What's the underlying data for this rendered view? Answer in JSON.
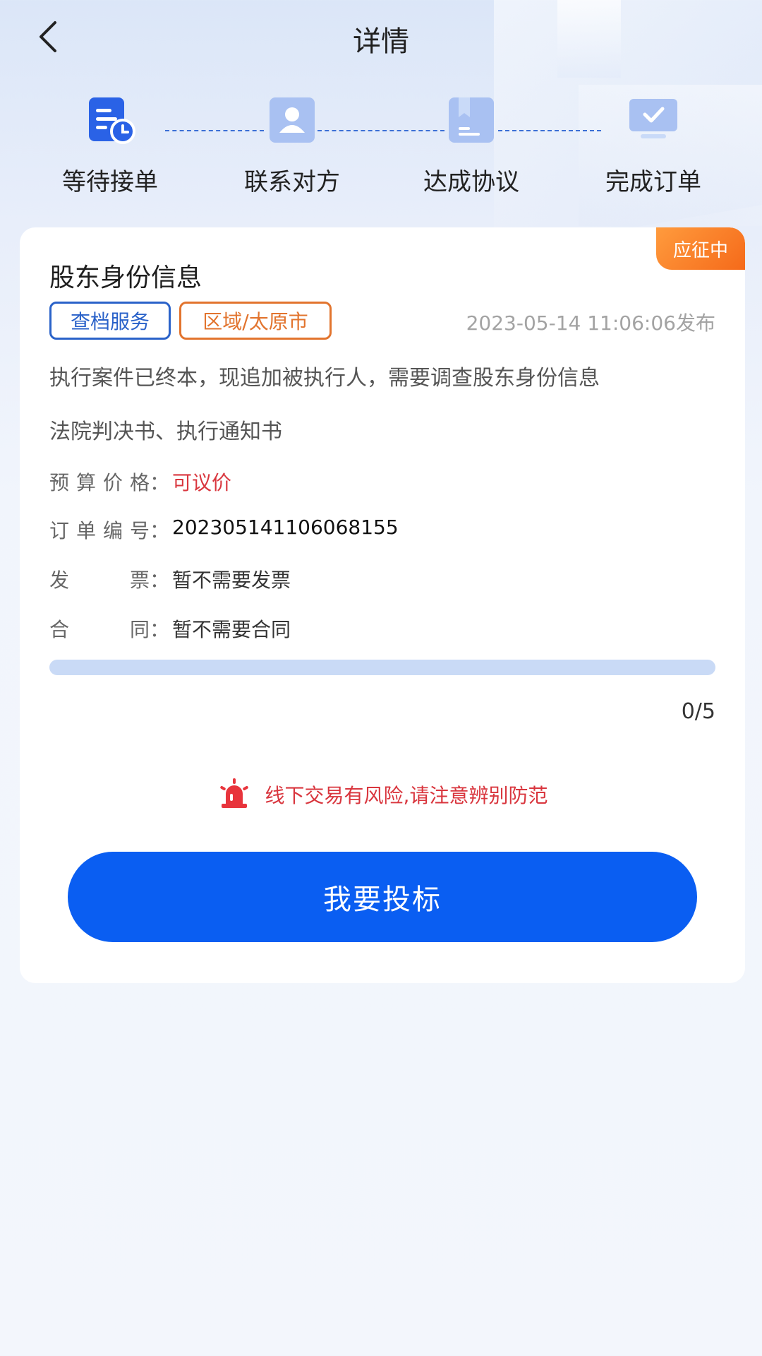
{
  "header": {
    "title": "详情"
  },
  "steps": [
    {
      "label": "等待接单",
      "icon": "pending-order-icon",
      "active": true
    },
    {
      "label": "联系对方",
      "icon": "contact-icon",
      "active": false
    },
    {
      "label": "达成协议",
      "icon": "agreement-icon",
      "active": false
    },
    {
      "label": "完成订单",
      "icon": "complete-order-icon",
      "active": false
    }
  ],
  "card": {
    "badge": "应征中",
    "title": "股东身份信息",
    "tags": [
      "查档服务",
      "区域/太原市"
    ],
    "published": "2023-05-14 11:06:06发布",
    "description": "执行案件已终本，现追加被执行人，需要调查股东身份信息",
    "documents": "法院判决书、执行通知书",
    "fields": [
      {
        "key": [
          "预",
          "算",
          "价",
          "格"
        ],
        "value": "可议价",
        "tone": "red"
      },
      {
        "key": [
          "订",
          "单",
          "编",
          "号"
        ],
        "value": "202305141106068155",
        "tone": "black"
      },
      {
        "key": [
          "发",
          "票"
        ],
        "value": "暂不需要发票",
        "tone": "normal"
      },
      {
        "key": [
          "合",
          "同"
        ],
        "value": "暂不需要合同",
        "tone": "normal"
      }
    ],
    "progress": {
      "current": 0,
      "total": 5,
      "label": "0/5"
    },
    "warning": "线下交易有风险,请注意辨别防范",
    "button": "我要投标"
  },
  "colors": {
    "accent": "#0a5ef2",
    "tag_blue": "#2a62c9",
    "tag_orange": "#e2742e",
    "warning_red": "#d9363e",
    "badge_orange": "#f56a1a"
  }
}
